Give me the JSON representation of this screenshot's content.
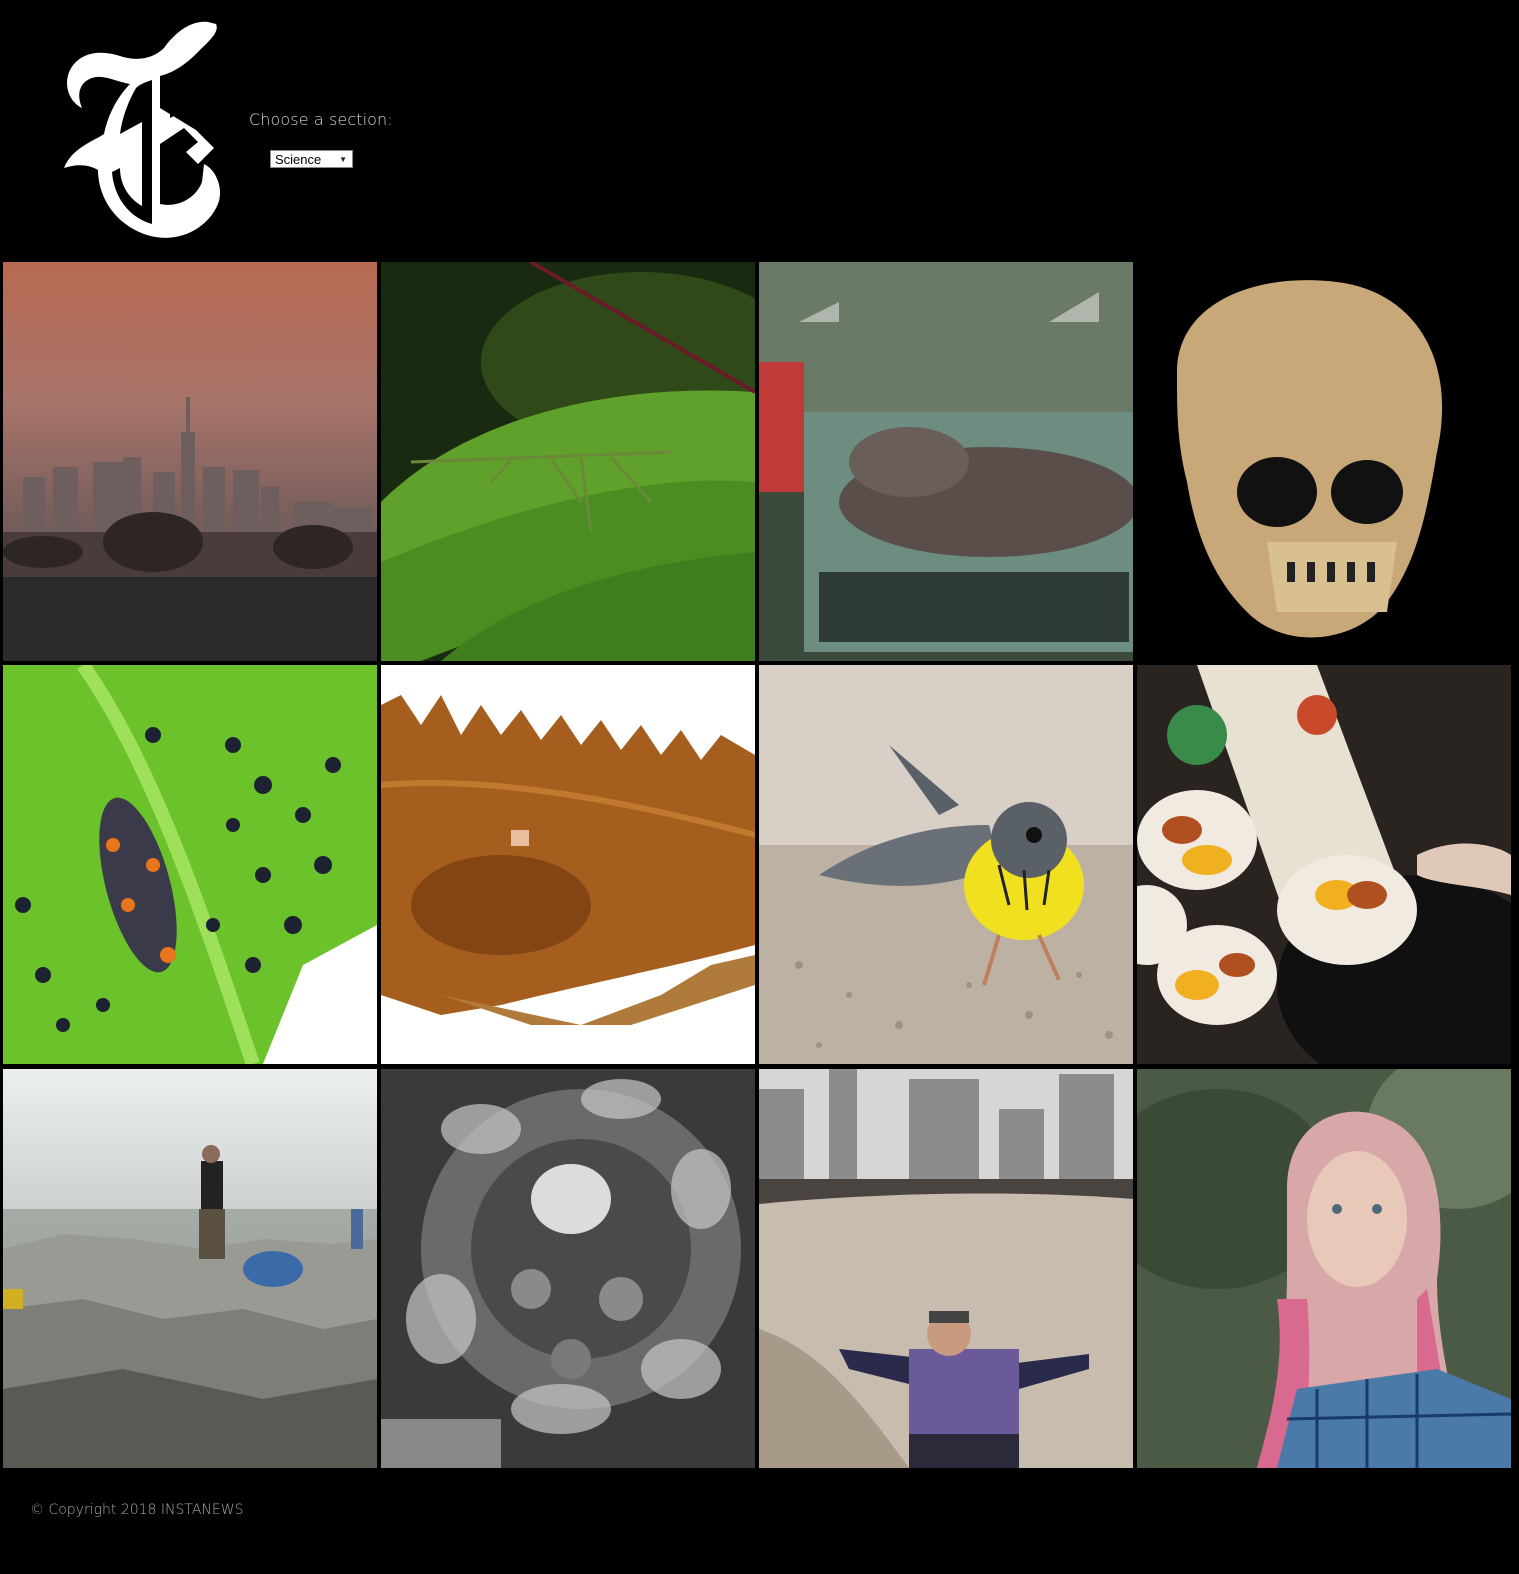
{
  "header": {
    "logo": "nyt-t-logo",
    "section_label": "Choose a section:",
    "section_select": {
      "selected": "Science"
    }
  },
  "grid": {
    "tiles": [
      {
        "icon": "city-skyline-haze-photo"
      },
      {
        "icon": "stick-insect-on-leaf-photo"
      },
      {
        "icon": "salamander-in-glass-tank-photo"
      },
      {
        "icon": "human-skull-photo"
      },
      {
        "icon": "ladybug-larva-aphids-photo"
      },
      {
        "icon": "fish-specimen-photo"
      },
      {
        "icon": "yellow-warbler-bird-photo"
      },
      {
        "icon": "thanksgiving-meal-plates-photo"
      },
      {
        "icon": "hiker-on-rocky-summit-photo"
      },
      {
        "icon": "microscope-cell-photo"
      },
      {
        "icon": "man-on-rock-in-park-photo"
      },
      {
        "icon": "woman-portrait-pink-hair-photo"
      }
    ]
  },
  "footer": {
    "copyright": "© Copyright 2018 INSTANEWS"
  },
  "colors": {
    "background": "#000000",
    "label_text": "#d8d8d8",
    "footer_text": "#a8a8a8"
  }
}
